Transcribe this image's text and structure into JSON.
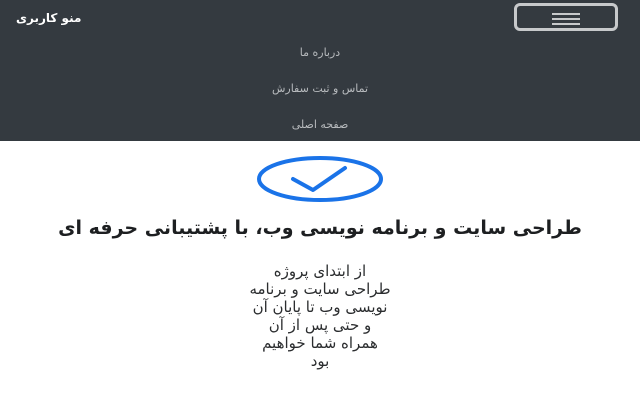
{
  "navbar": {
    "brand": "منو کاربری",
    "toggler_icon": "hamburger-menu-icon",
    "items": [
      {
        "label": "درباره ما"
      },
      {
        "label": "تماس و ثبت سفارش"
      },
      {
        "label": "صفحه اصلی"
      }
    ]
  },
  "hero": {
    "icon": "check-icon",
    "icon_color": "#1a73e8",
    "title": "طراحی سایت و برنامه نویسی وب، با پشتیبانی حرفه ای",
    "text": "از ابتدای پروژه\nطراحی سایت و برنامه\nنویسی وب تا پایان آن\nو حتی پس از آن\nهمراه شما خواهیم\nبود"
  },
  "colors": {
    "navbar_bg": "#343a40",
    "nav_text": "#b8bbbe",
    "accent": "#1a73e8"
  }
}
